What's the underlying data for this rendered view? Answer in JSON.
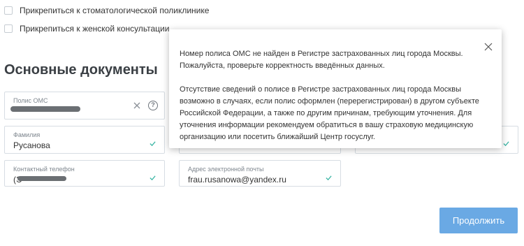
{
  "checkboxes": [
    {
      "label": "Прикрепиться к стоматологической поликлинике"
    },
    {
      "label": "Прикрепиться к женской консультации"
    }
  ],
  "section_title": "Основные документы",
  "fields": {
    "oms": {
      "label": "Полис ОМС",
      "value": ""
    },
    "surname": {
      "label": "Фамилия",
      "value": "Русанова"
    },
    "phone": {
      "label": "Контактный телефон",
      "value": "(Э"
    },
    "email": {
      "label": "Адрес электронной почты",
      "value": "frau.rusanowa@yandex.ru"
    }
  },
  "info_icon_text": "?",
  "continue_button": "Продолжить",
  "modal": {
    "paragraph1": "Номер полиса ОМС не найден в Регистре застрахованных лиц города Москвы. Пожалуйста, проверьте корректность введённых данных.",
    "paragraph2": "Отсутствие сведений о полисе в Регистре застрахованных лиц города Москвы возможно в случаях, если полис оформлен (перерегистрирован) в другом субъекте Российской Федерации, а также по другим причинам, требующим уточнения. Для уточнения информации рекомендуем обратиться в вашу страховую медицинскую организацию или посетить ближайший Центр госуслуг."
  },
  "colors": {
    "accent": "#6aa9e4",
    "check": "#39b5a4"
  }
}
